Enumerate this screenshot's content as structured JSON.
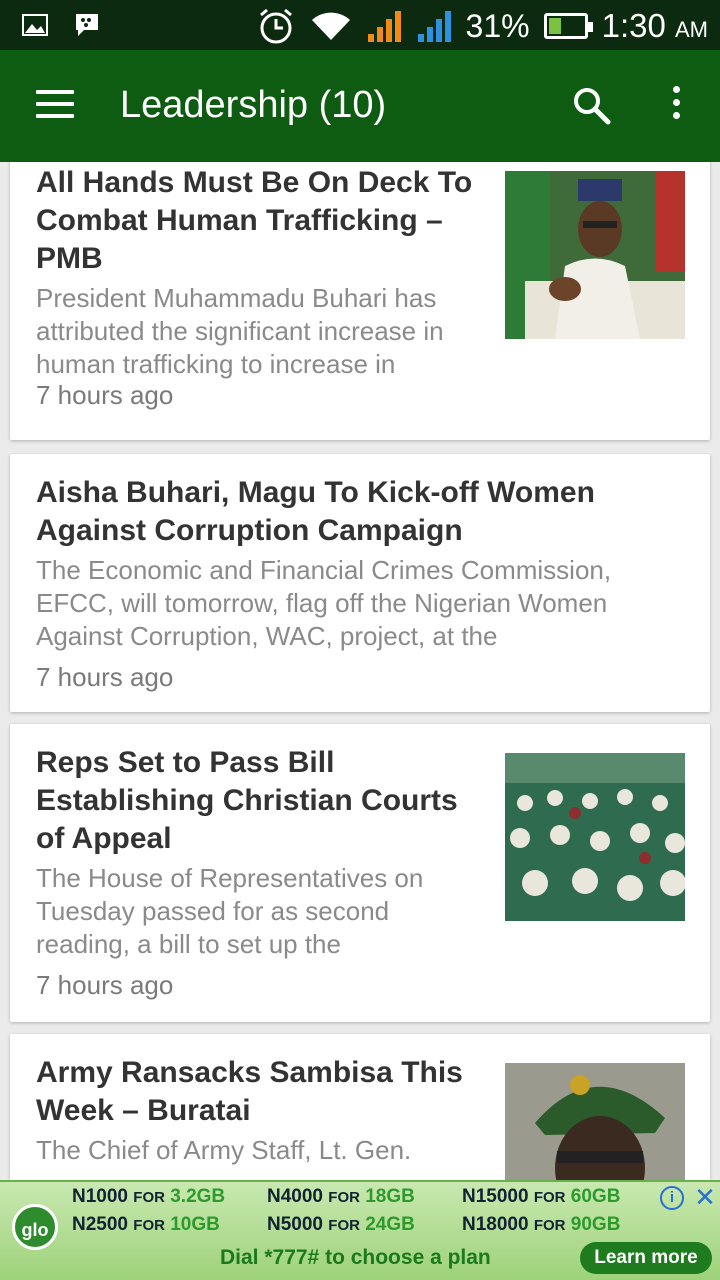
{
  "status_bar": {
    "battery": "31%",
    "time": "1:30",
    "ampm": "AM",
    "icons": [
      "image-icon",
      "bbm-icon",
      "alarm-icon",
      "wifi-icon",
      "signal-icon",
      "signal-icon-2",
      "battery-icon"
    ],
    "battery_level": 0.31
  },
  "app_bar": {
    "title": "Leadership (10)",
    "icons": [
      "menu-icon",
      "search-icon",
      "more-vert-icon"
    ]
  },
  "articles": [
    {
      "title": "All Hands Must Be On Deck To Combat Human Trafficking – PMB",
      "title_lines": [
        "All Hands Must Be On Deck To",
        "Combat Human Trafficking –",
        "PMB"
      ],
      "snippet_lines": [
        "President Muhammadu Buhari has",
        "attributed the significant increase in",
        "human trafficking to increase in"
      ],
      "time": "7 hours ago",
      "has_image": true
    },
    {
      "title_lines": [
        "Aisha Buhari, Magu To Kick-off Women",
        "Against Corruption Campaign"
      ],
      "snippet_lines": [
        "The Economic and Financial Crimes Commission,",
        "EFCC, will tomorrow,  flag off the Nigerian Women",
        "Against Corruption, WAC, project, at the"
      ],
      "time": "7 hours ago",
      "has_image": false
    },
    {
      "title_lines": [
        "Reps Set to Pass Bill",
        "Establishing Christian Courts",
        "of Appeal"
      ],
      "snippet_lines": [
        "The House of Representatives on",
        "Tuesday passed for as second",
        "reading, a bill to set up the"
      ],
      "time": "7 hours ago",
      "has_image": true
    },
    {
      "title_lines": [
        "Army Ransacks Sambisa This",
        "Week – Buratai"
      ],
      "snippet_lines": [
        "The Chief of Army Staff, Lt. Gen."
      ],
      "time": "",
      "has_image": true
    }
  ],
  "ad": {
    "logo": "glo",
    "row1": [
      {
        "price": "N1000",
        "for": "FOR",
        "gb": "3.2GB"
      },
      {
        "price": "N4000",
        "for": "FOR",
        "gb": "18GB"
      },
      {
        "price": "N15000",
        "for": "FOR",
        "gb": "60GB"
      }
    ],
    "row2": [
      {
        "price": "N2500",
        "for": "FOR",
        "gb": "10GB"
      },
      {
        "price": "N5000",
        "for": "FOR",
        "gb": "24GB"
      },
      {
        "price": "N18000",
        "for": "FOR",
        "gb": "90GB"
      }
    ],
    "dial": "Dial *777# to choose a plan",
    "cta": "Learn more",
    "info": "i",
    "close": "✕"
  },
  "colors": {
    "app_bar": "#0e5c12",
    "status_bar": "#0b2a0f",
    "background": "#ebebeb"
  }
}
